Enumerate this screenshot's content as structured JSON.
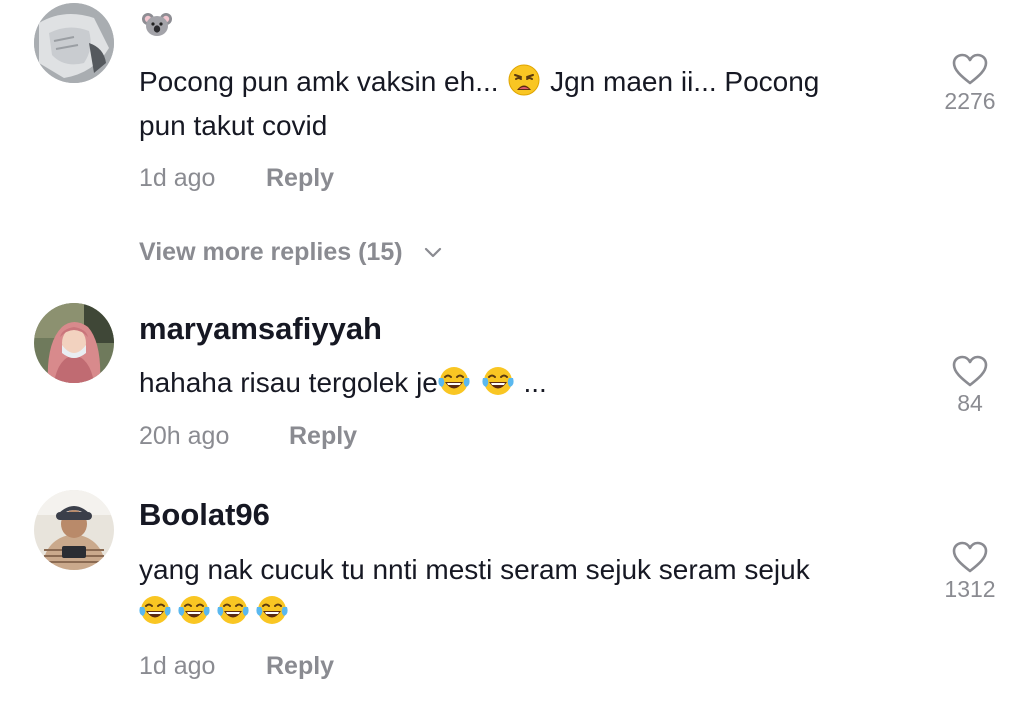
{
  "comments": [
    {
      "username": "",
      "username_emoji": "koala-emoji",
      "line1_a": "Pocong pun amk vaksin eh...",
      "line1_emoji": "weary-face-emoji",
      "line1_b": "Jgn maen ii... Pocong",
      "line2": "pun takut covid",
      "time": "1d ago",
      "reply_label": "Reply",
      "likes": "2276",
      "view_more": "View more replies (15)"
    },
    {
      "username": "maryamsafiyyah",
      "line1_a": "hahaha risau tergolek je",
      "line1_emojis": [
        "face-with-tears-of-joy-emoji",
        "face-with-tears-of-joy-emoji"
      ],
      "line1_b": "...",
      "time": "20h ago",
      "reply_label": "Reply",
      "likes": "84"
    },
    {
      "username": "Boolat96",
      "line1": "yang nak cucuk tu nnti mesti seram sejuk seram sejuk",
      "line2_emojis": [
        "face-with-tears-of-joy-emoji",
        "face-with-tears-of-joy-emoji",
        "face-with-tears-of-joy-emoji",
        "face-with-tears-of-joy-emoji"
      ],
      "time": "1d ago",
      "reply_label": "Reply",
      "likes": "1312"
    }
  ],
  "colors": {
    "text": "#161823",
    "muted": "#8a8b91",
    "background": "#ffffff"
  },
  "icons": {
    "like": "heart-outline-icon",
    "expand": "chevron-down-icon"
  }
}
